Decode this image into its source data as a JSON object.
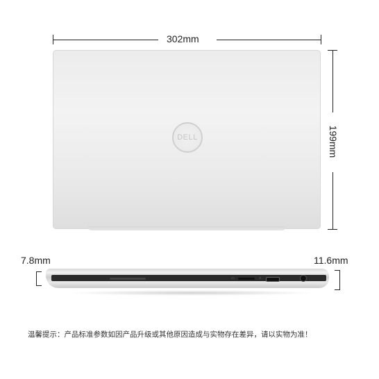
{
  "dimensions": {
    "width": "302mm",
    "height": "199mm",
    "thin_edge": "7.8mm",
    "thick_edge": "11.6mm"
  },
  "logo": {
    "text": "DELL"
  },
  "notice": "温馨提示：产品标准参数如因产品升级或其他原因造成与实物存在差异，请以实物为准！"
}
